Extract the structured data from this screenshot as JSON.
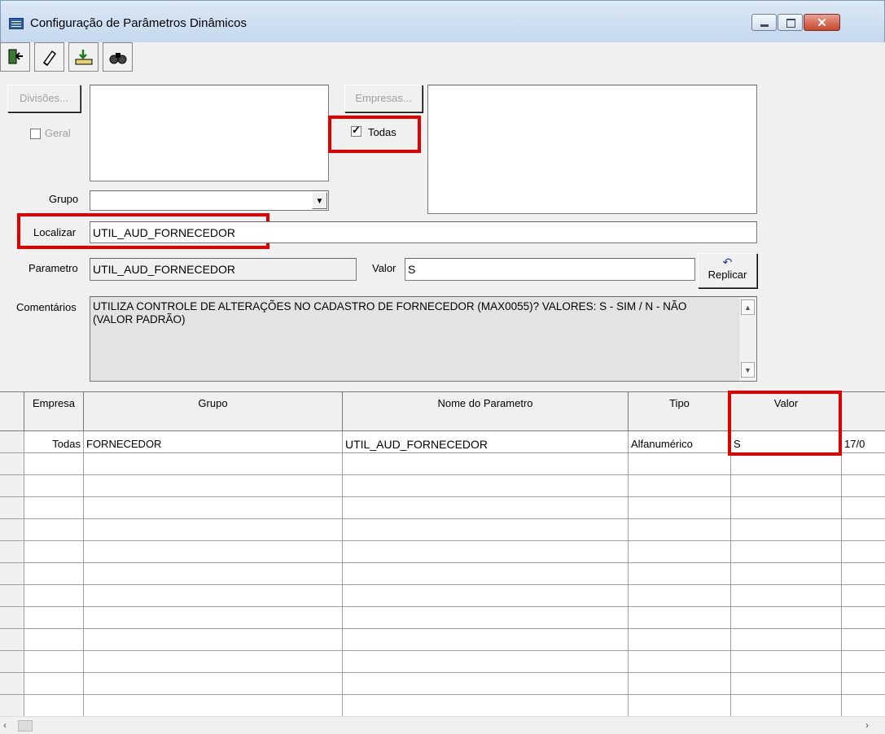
{
  "window": {
    "title": "Configuração de Parâmetros Dinâmicos"
  },
  "toolbar": {
    "icons": [
      "exit-icon",
      "eraser-icon",
      "save-icon",
      "find-icon"
    ]
  },
  "divisoes": {
    "button_label": "Divisões..."
  },
  "geral": {
    "label": "Geral",
    "checked": false
  },
  "empresas": {
    "button_label": "Empresas..."
  },
  "todas": {
    "label": "Todas",
    "checked": true
  },
  "grupo": {
    "label": "Grupo",
    "value": ""
  },
  "localizar": {
    "label": "Localizar",
    "value": "UTIL_AUD_FORNECEDOR"
  },
  "parametro": {
    "label": "Parametro",
    "value": "UTIL_AUD_FORNECEDOR"
  },
  "valor": {
    "label": "Valor",
    "value": "S"
  },
  "replicar": {
    "label": "Replicar"
  },
  "comentarios": {
    "label": "Comentários",
    "value": "UTILIZA CONTROLE DE ALTERAÇÕES NO CADASTRO DE FORNECEDOR (MAX0055)? VALORES: S - SIM / N - NÃO (VALOR PADRÃO)"
  },
  "grid": {
    "headers": [
      "Empresa",
      "Grupo",
      "Nome do Parametro",
      "Tipo",
      "Valor"
    ],
    "rows": [
      {
        "empresa": "Todas",
        "grupo": "FORNECEDOR",
        "nome": "UTIL_AUD_FORNECEDOR",
        "tipo": "Alfanumérico",
        "valor": "S",
        "extra": "17/0"
      }
    ]
  },
  "colors": {
    "highlight": "#e00000",
    "title_bar": "#c5d8ee",
    "close_button": "#c7452c"
  }
}
